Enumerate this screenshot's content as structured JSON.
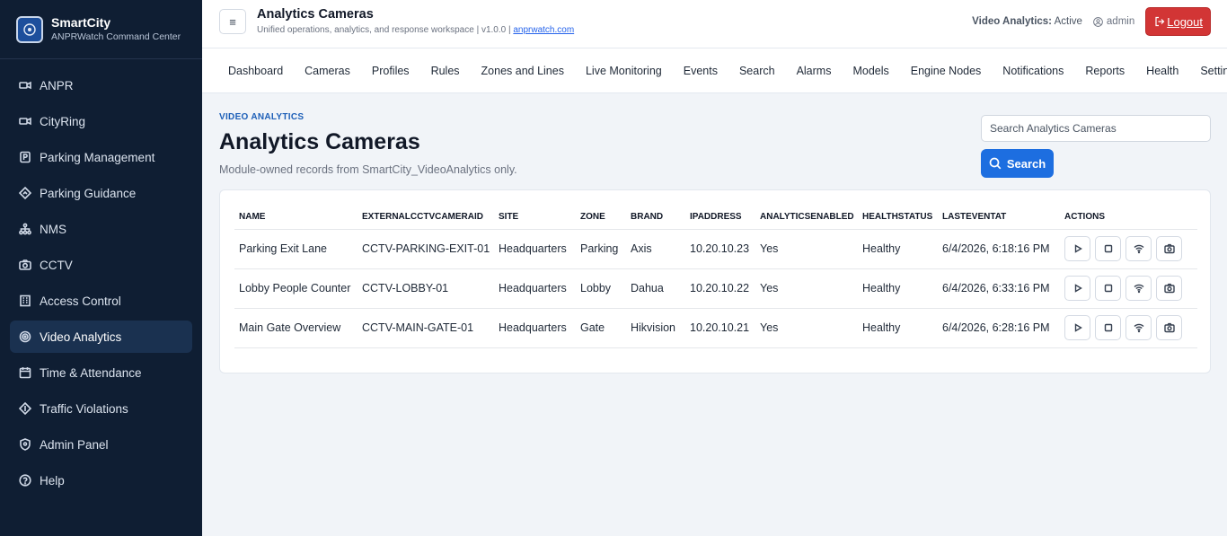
{
  "brand": {
    "name": "SmartCity",
    "subtitle": "ANPRWatch Command Center"
  },
  "sidebar": {
    "items": [
      {
        "label": "ANPR",
        "icon": "camera-icon"
      },
      {
        "label": "CityRing",
        "icon": "camera-icon"
      },
      {
        "label": "Parking Management",
        "icon": "parking-icon"
      },
      {
        "label": "Parking Guidance",
        "icon": "diamond-icon"
      },
      {
        "label": "NMS",
        "icon": "network-icon"
      },
      {
        "label": "CCTV",
        "icon": "photo-camera-icon"
      },
      {
        "label": "Access Control",
        "icon": "building-icon"
      },
      {
        "label": "Video Analytics",
        "icon": "target-icon",
        "active": true
      },
      {
        "label": "Time & Attendance",
        "icon": "calendar-icon"
      },
      {
        "label": "Traffic Violations",
        "icon": "diamond-icon"
      },
      {
        "label": "Admin Panel",
        "icon": "shield-icon"
      },
      {
        "label": "Help",
        "icon": "help-icon"
      }
    ]
  },
  "header": {
    "menu_icon": "≡",
    "title": "Analytics Cameras",
    "subtitle": "Unified operations, analytics, and response workspace | v1.0.0 |",
    "link": "anprwatch.com",
    "status_label": "Video Analytics:",
    "status_value": "Active",
    "user": "admin",
    "logout_label": "Logout"
  },
  "topnav": [
    "Dashboard",
    "Cameras",
    "Profiles",
    "Rules",
    "Zones and Lines",
    "Live Monitoring",
    "Events",
    "Search",
    "Alarms",
    "Models",
    "Engine Nodes",
    "Notifications",
    "Reports",
    "Health",
    "Settings"
  ],
  "page": {
    "section": "VIDEO ANALYTICS",
    "title": "Analytics Cameras",
    "description": "Module-owned records from SmartCity_VideoAnalytics only.",
    "search_placeholder": "Search Analytics Cameras",
    "search_button": "Search"
  },
  "table": {
    "columns": [
      "NAME",
      "EXTERNALCCTVCAMERAID",
      "SITE",
      "ZONE",
      "BRAND",
      "IPADDRESS",
      "ANALYTICSENABLED",
      "HEALTHSTATUS",
      "LASTEVENTAT",
      "ACTIONS"
    ],
    "rows": [
      [
        "Parking Exit Lane",
        "CCTV-PARKING-EXIT-01",
        "Headquarters",
        "Parking",
        "Axis",
        "10.20.10.23",
        "Yes",
        "Healthy",
        "6/4/2026, 6:18:16 PM"
      ],
      [
        "Lobby People Counter",
        "CCTV-LOBBY-01",
        "Headquarters",
        "Lobby",
        "Dahua",
        "10.20.10.22",
        "Yes",
        "Healthy",
        "6/4/2026, 6:33:16 PM"
      ],
      [
        "Main Gate Overview",
        "CCTV-MAIN-GATE-01",
        "Headquarters",
        "Gate",
        "Hikvision",
        "10.20.10.21",
        "Yes",
        "Healthy",
        "6/4/2026, 6:28:16 PM"
      ]
    ],
    "actions": [
      "play-icon",
      "stop-icon",
      "wifi-icon",
      "snapshot-icon"
    ]
  },
  "colors": {
    "sidebar_bg": "#0f1e33",
    "accent": "#1d6ee0",
    "logout": "#d23535"
  }
}
